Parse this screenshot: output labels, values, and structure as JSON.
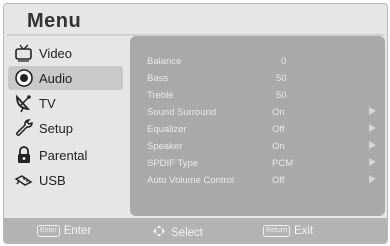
{
  "title": "Menu",
  "sidebar": {
    "items": [
      {
        "label": "Video",
        "icon": "tv-set-icon"
      },
      {
        "label": "Audio",
        "icon": "speaker-icon",
        "selected": true
      },
      {
        "label": "TV",
        "icon": "satellite-dish-icon"
      },
      {
        "label": "Setup",
        "icon": "wrench-icon"
      },
      {
        "label": "Parental",
        "icon": "padlock-icon"
      },
      {
        "label": "USB",
        "icon": "usb-plug-icon"
      }
    ]
  },
  "settings": [
    {
      "label": "Balance",
      "value": "0"
    },
    {
      "label": "Bass",
      "value": "50"
    },
    {
      "label": "Treble",
      "value": "50"
    },
    {
      "label": "Sound Surround",
      "value": "On",
      "submenu": true
    },
    {
      "label": "Equalizer",
      "value": "Off",
      "submenu": true
    },
    {
      "label": "Speaker",
      "value": "On",
      "submenu": true
    },
    {
      "label": "SPDIF Type",
      "value": "PCM",
      "submenu": true
    },
    {
      "label": "Auto Volume Control",
      "value": "Off",
      "submenu": true
    }
  ],
  "footer": {
    "enter_key": "Enter",
    "enter_label": "Enter",
    "select_label": "Select",
    "return_key": "Return",
    "exit_label": "Exit"
  }
}
